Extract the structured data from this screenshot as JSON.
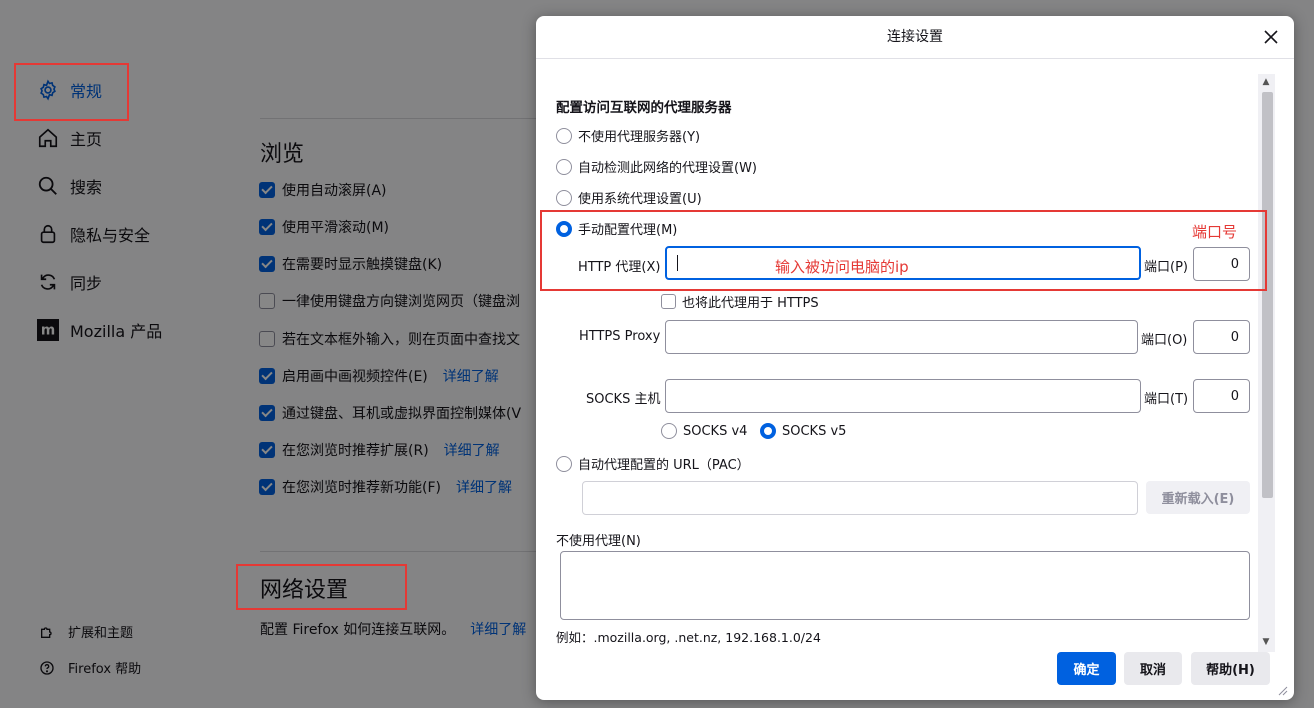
{
  "sidebar": {
    "items": [
      {
        "label": "常规",
        "icon": "gear-icon"
      },
      {
        "label": "主页",
        "icon": "home-icon"
      },
      {
        "label": "搜索",
        "icon": "search-icon"
      },
      {
        "label": "隐私与安全",
        "icon": "lock-icon"
      },
      {
        "label": "同步",
        "icon": "sync-icon"
      },
      {
        "label": "Mozilla 产品",
        "icon": "mozilla-icon"
      }
    ],
    "bottom": [
      {
        "label": "扩展和主题",
        "icon": "puzzle-icon"
      },
      {
        "label": "Firefox 帮助",
        "icon": "help-icon"
      }
    ]
  },
  "browse": {
    "title": "浏览",
    "options": [
      {
        "label": "使用自动滚屏(A)",
        "checked": true,
        "link": ""
      },
      {
        "label": "使用平滑滚动(M)",
        "checked": true,
        "link": ""
      },
      {
        "label": "在需要时显示触摸键盘(K)",
        "checked": true,
        "link": ""
      },
      {
        "label": "一律使用键盘方向键浏览网页（键盘浏",
        "checked": false,
        "link": ""
      },
      {
        "label": "若在文本框外输入，则在页面中查找文",
        "checked": false,
        "link": ""
      },
      {
        "label": "启用画中画视频控件(E)",
        "checked": true,
        "link": "详细了解"
      },
      {
        "label": "通过键盘、耳机或虚拟界面控制媒体(V",
        "checked": true,
        "link": ""
      },
      {
        "label": "在您浏览时推荐扩展(R)",
        "checked": true,
        "link": "详细了解"
      },
      {
        "label": "在您浏览时推荐新功能(F)",
        "checked": true,
        "link": "详细了解"
      }
    ]
  },
  "network": {
    "title": "网络设置",
    "desc": "配置 Firefox 如何连接互联网。",
    "link": "详细了解"
  },
  "dialog": {
    "title": "连接设置",
    "heading": "配置访问互联网的代理服务器",
    "opt_none": "不使用代理服务器(Y)",
    "opt_auto_detect": "自动检测此网络的代理设置(W)",
    "opt_system": "使用系统代理设置(U)",
    "opt_manual": "手动配置代理(M)",
    "http_label": "HTTP 代理(X)",
    "http_value": "",
    "http_port_label": "端口(P)",
    "http_port": "0",
    "also_https": "也将此代理用于 HTTPS",
    "https_label": "HTTPS Proxy",
    "https_value": "",
    "https_port_label": "端口(O)",
    "https_port": "0",
    "socks_label": "SOCKS 主机",
    "socks_value": "",
    "socks_port_label": "端口(T)",
    "socks_port": "0",
    "socks_v4": "SOCKS v4",
    "socks_v5": "SOCKS v5",
    "opt_pac": "自动代理配置的 URL（PAC）",
    "pac_value": "",
    "reload_label": "重新载入(E)",
    "no_proxy_label": "不使用代理(N)",
    "no_proxy_value": "",
    "example": "例如：.mozilla.org, .net.nz, 192.168.1.0/24",
    "ok": "确定",
    "cancel": "取消",
    "help": "帮助(H)"
  },
  "annotations": {
    "ip_hint": "输入被访问电脑的ip",
    "port_hint": "端口号",
    "color": "#e53935"
  },
  "colors": {
    "accent": "#0061e0",
    "annotation_red": "#e53935"
  }
}
